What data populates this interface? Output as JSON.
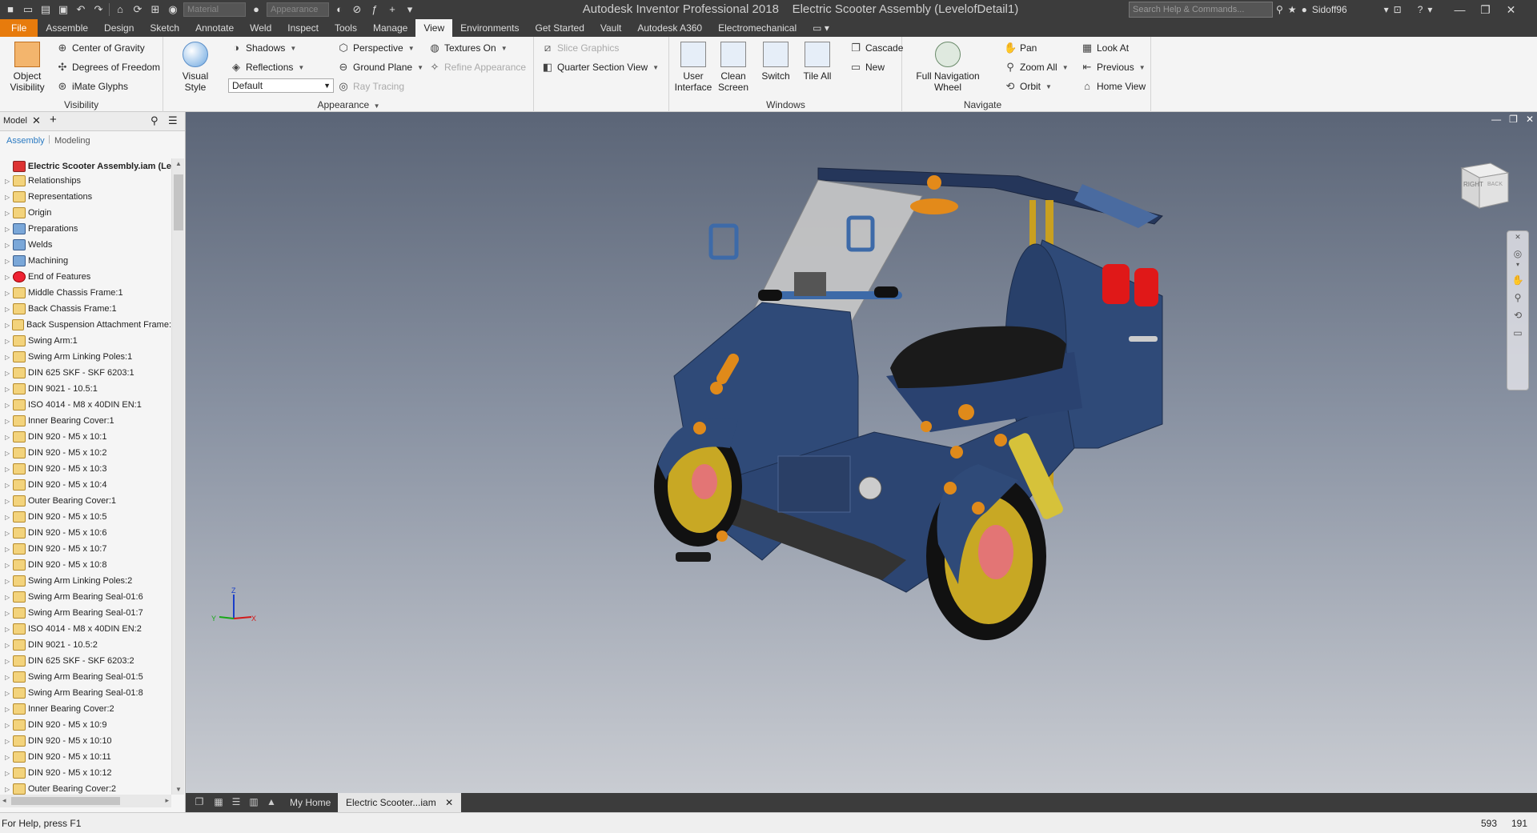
{
  "titlebar": {
    "material_dd": "Material",
    "appearance_dd": "Appearance",
    "app_name": "Autodesk Inventor Professional 2018",
    "doc_name": "Electric Scooter Assembly (LevelofDetail1)",
    "search_placeholder": "Search Help & Commands...",
    "user": "Sidoff96"
  },
  "tabs": [
    "File",
    "Assemble",
    "Design",
    "Sketch",
    "Annotate",
    "Weld",
    "Inspect",
    "Tools",
    "Manage",
    "View",
    "Environments",
    "Get Started",
    "Vault",
    "Autodesk A360",
    "Electromechanical"
  ],
  "active_tab": "View",
  "ribbon": {
    "visibility": {
      "label": "Visibility",
      "object_visibility": [
        "Object",
        "Visibility"
      ],
      "center_of_gravity": "Center of Gravity",
      "degrees_of_freedom": "Degrees of Freedom",
      "imate_glyphs": "iMate Glyphs"
    },
    "appearance": {
      "label": "Appearance",
      "visual_style": "Visual Style",
      "shadows": "Shadows",
      "reflections": "Reflections",
      "default": "Default",
      "perspective": "Perspective",
      "ground_plane": "Ground Plane",
      "ray_tracing": "Ray Tracing",
      "textures_on": "Textures On",
      "refine_appearance": "Refine Appearance",
      "slice_graphics": "Slice Graphics",
      "quarter_section_view": "Quarter Section View"
    },
    "windows": {
      "label": "Windows",
      "user_interface": [
        "User",
        "Interface"
      ],
      "clean_screen": [
        "Clean",
        "Screen"
      ],
      "switch": "Switch",
      "tile_all": "Tile All",
      "cascade": "Cascade",
      "new": "New"
    },
    "navigate": {
      "label": "Navigate",
      "full_navigation_wheel": [
        "Full Navigation",
        "Wheel"
      ],
      "pan": "Pan",
      "zoom_all": "Zoom All",
      "orbit": "Orbit",
      "look_at": "Look At",
      "previous": "Previous",
      "home_view": "Home View"
    }
  },
  "browser": {
    "tab": "Model",
    "sub_assembly": "Assembly",
    "sub_modeling": "Modeling",
    "root": "Electric Scooter Assembly.iam (Le",
    "nodes": [
      "Relationships",
      "Representations",
      "Origin",
      "Preparations",
      "Welds",
      "Machining",
      "End of Features",
      "Middle Chassis Frame:1",
      "Back Chassis Frame:1",
      "Back Suspension Attachment Frame:",
      "Swing Arm:1",
      "Swing Arm Linking Poles:1",
      "DIN 625 SKF - SKF 6203:1",
      "DIN 9021 - 10.5:1",
      "ISO 4014 - M8 x 40DIN EN:1",
      "Inner Bearing  Cover:1",
      "DIN 920 - M5 x 10:1",
      "DIN 920 - M5 x 10:2",
      "DIN 920 - M5 x 10:3",
      "DIN 920 - M5 x 10:4",
      "Outer Bearing Cover:1",
      "DIN 920 - M5 x 10:5",
      "DIN 920 - M5 x 10:6",
      "DIN 920 - M5 x 10:7",
      "DIN 920 - M5 x 10:8",
      "Swing Arm Linking Poles:2",
      "Swing Arm Bearing Seal-01:6",
      "Swing Arm Bearing Seal-01:7",
      "ISO 4014 - M8 x 40DIN EN:2",
      "DIN 9021 - 10.5:2",
      "DIN 625 SKF - SKF 6203:2",
      "Swing Arm Bearing Seal-01:5",
      "Swing Arm Bearing Seal-01:8",
      "Inner Bearing  Cover:2",
      "DIN 920 - M5 x 10:9",
      "DIN 920 - M5 x 10:10",
      "DIN 920 - M5 x 10:11",
      "DIN 920 - M5 x 10:12",
      "Outer Bearing Cover:2"
    ]
  },
  "viewcube": {
    "face_right": "RIGHT",
    "face_back": "BACK"
  },
  "triad": {
    "z": "Z",
    "x": "X",
    "y": "Y"
  },
  "doctabs": {
    "home": "My Home",
    "active_doc": "Electric Scooter...iam"
  },
  "status": {
    "help": "For Help, press F1",
    "val1": "593",
    "val2": "191"
  },
  "colors": {
    "file_tab": "#e77b0c",
    "scooter_body": "#2f4a78",
    "accent_orange": "#e08a1a"
  }
}
